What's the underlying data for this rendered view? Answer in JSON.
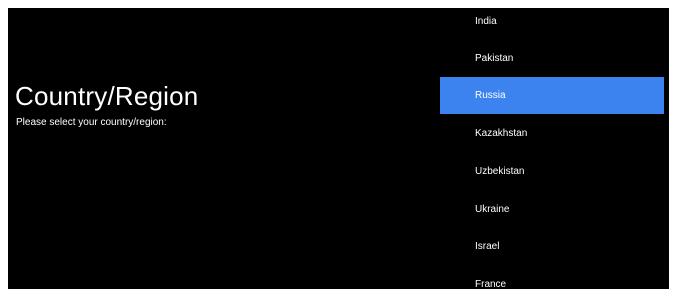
{
  "page": {
    "title": "Country/Region",
    "subtitle": "Please select your country/region:"
  },
  "country_list": {
    "selected_index": 2,
    "accent_color": "#3c83f0",
    "items": [
      {
        "label": "India"
      },
      {
        "label": "Pakistan"
      },
      {
        "label": "Russia"
      },
      {
        "label": "Kazakhstan"
      },
      {
        "label": "Uzbekistan"
      },
      {
        "label": "Ukraine"
      },
      {
        "label": "Israel"
      },
      {
        "label": "France"
      }
    ]
  }
}
